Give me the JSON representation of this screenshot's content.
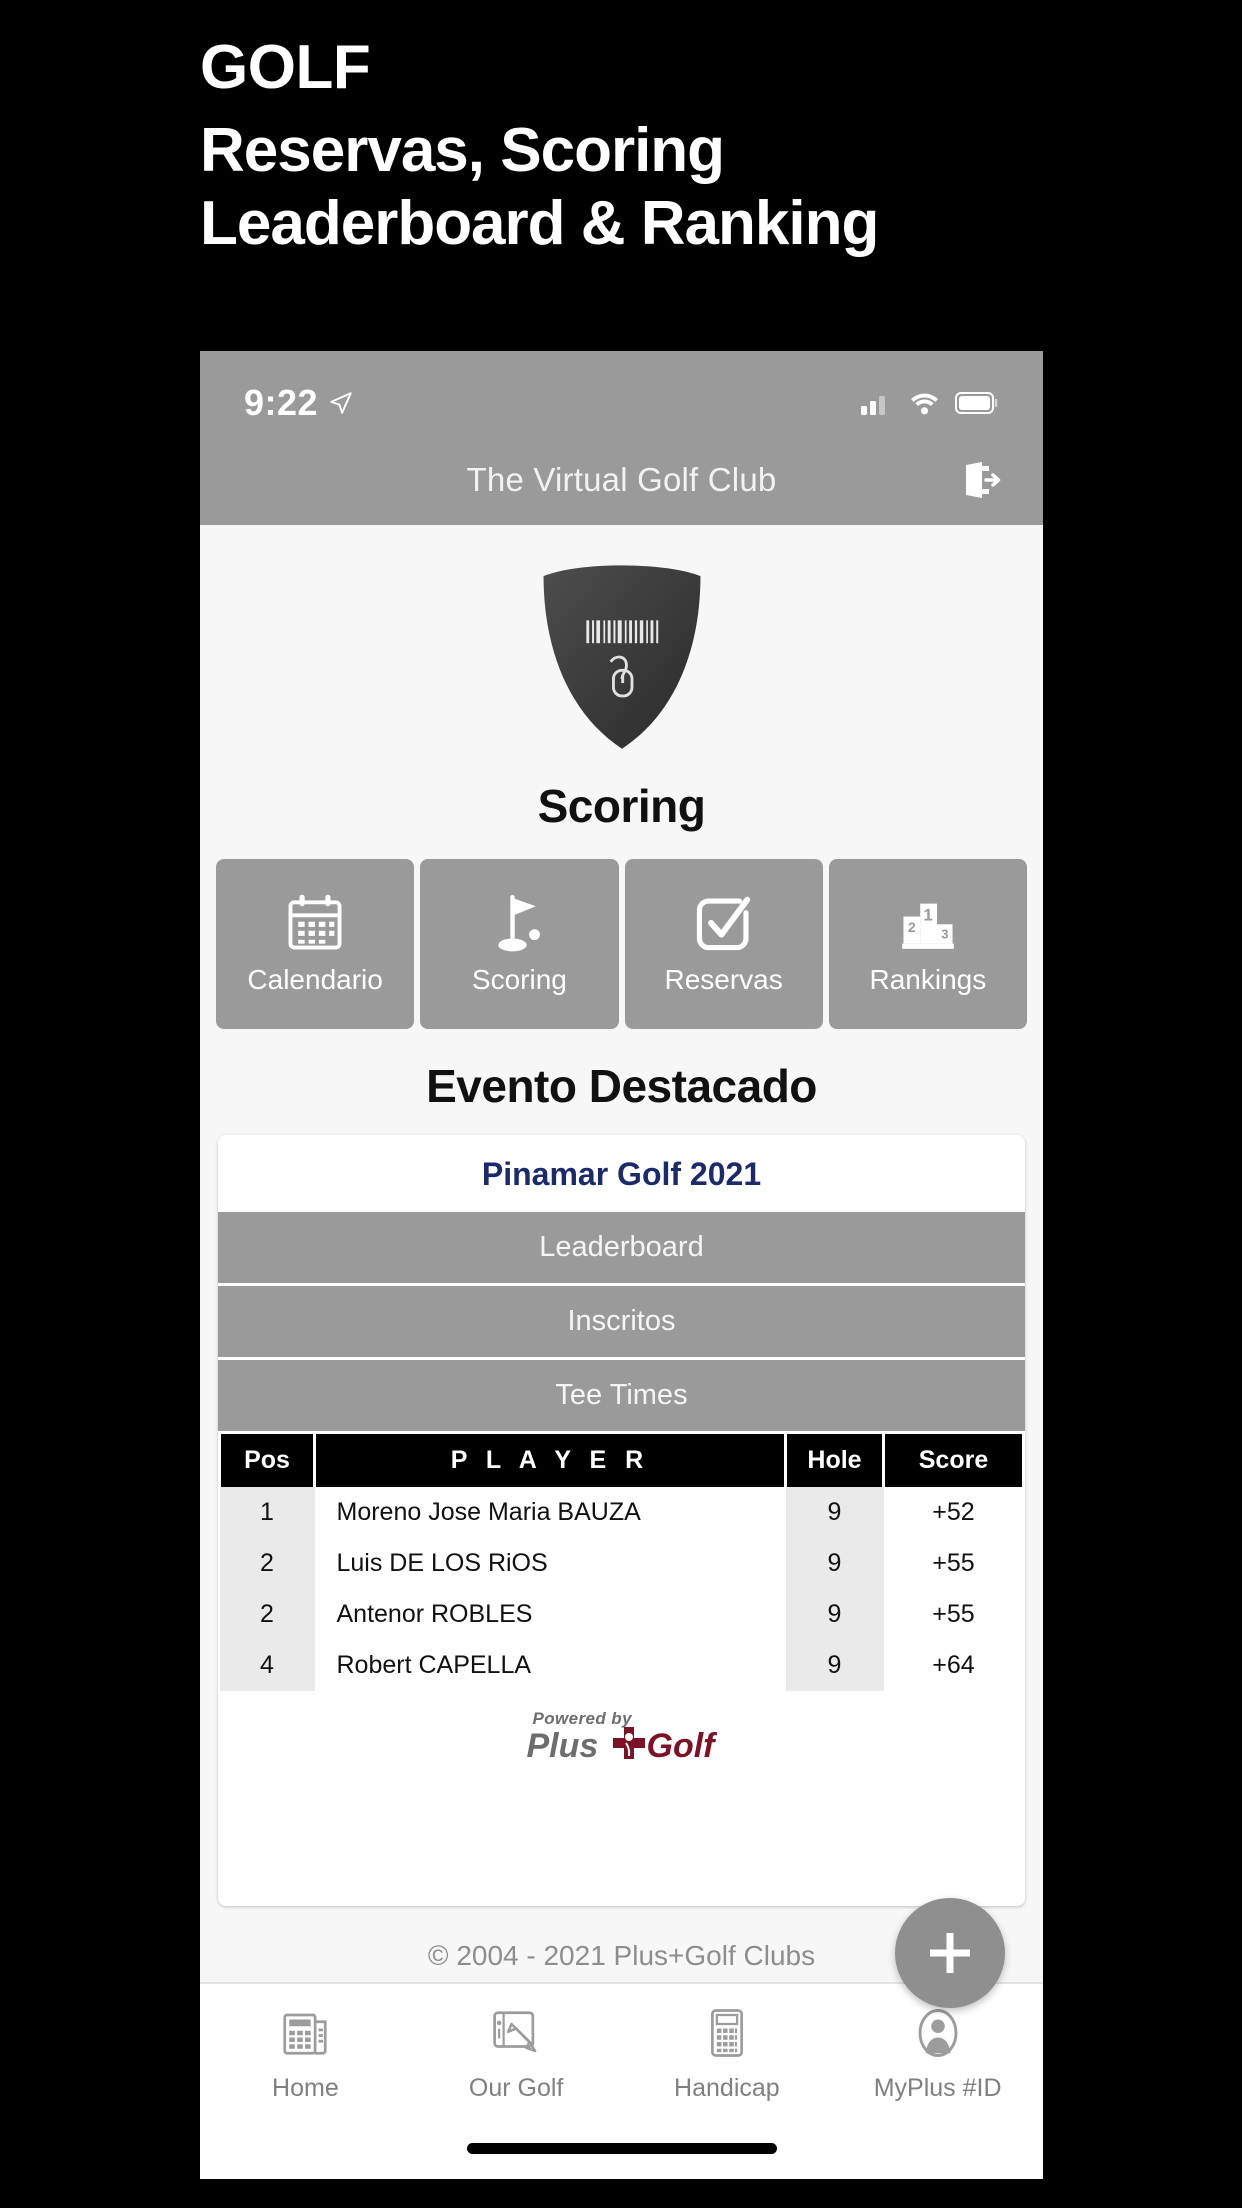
{
  "promo": {
    "kicker": "GOLF",
    "line1": "Reservas, Scoring",
    "line2": "Leaderboard & Ranking"
  },
  "statusbar": {
    "time": "9:22",
    "location_icon": "location-arrow-icon",
    "cellular_icon": "cellular-bars-icon",
    "wifi_icon": "wifi-icon",
    "battery_icon": "battery-icon"
  },
  "appbar": {
    "title": "The Virtual Golf Club",
    "logout_icon": "logout-icon"
  },
  "brand": {
    "shield_icon": "shield-badge-icon"
  },
  "page": {
    "title": "Scoring",
    "featured_heading": "Evento Destacado"
  },
  "tiles": [
    {
      "label": "Calendario",
      "icon": "calendar-icon"
    },
    {
      "label": "Scoring",
      "icon": "golf-flag-icon"
    },
    {
      "label": "Reservas",
      "icon": "check-square-icon"
    },
    {
      "label": "Rankings",
      "icon": "podium-icon"
    }
  ],
  "event": {
    "name": "Pinamar Golf 2021",
    "buttons": [
      "Leaderboard",
      "Inscritos",
      "Tee Times"
    ]
  },
  "leaderboard": {
    "headers": [
      "Pos",
      "P L A Y E R",
      "Hole",
      "Score"
    ],
    "rows": [
      {
        "pos": "1",
        "player": "Moreno Jose Maria BAUZA",
        "hole": "9",
        "score": "+52"
      },
      {
        "pos": "2",
        "player": "Luis DE LOS RiOS",
        "hole": "9",
        "score": "+55"
      },
      {
        "pos": "2",
        "player": "Antenor ROBLES",
        "hole": "9",
        "score": "+55"
      },
      {
        "pos": "4",
        "player": "Robert CAPELLA",
        "hole": "9",
        "score": "+64"
      }
    ]
  },
  "powered_by": {
    "prefix": "Powered by",
    "word1": "Plus",
    "word2": "Golf",
    "cross_icon": "plus-cross-icon"
  },
  "footer": {
    "copyright": "© 2004 - 2021 Plus+Golf Clubs",
    "fab_icon": "plus-icon"
  },
  "tabbar": [
    {
      "label": "Home",
      "icon": "newspaper-icon"
    },
    {
      "label": "Our Golf",
      "icon": "tablet-pen-icon"
    },
    {
      "label": "Handicap",
      "icon": "calculator-icon"
    },
    {
      "label": "MyPlus #ID",
      "icon": "person-icon"
    }
  ],
  "colors": {
    "backdrop": "#000000",
    "chrome_gray": "#9a9a9a",
    "event_title": "#1a2a6b",
    "golf_red": "#7d1126",
    "screen_bg": "#f7f7f7"
  }
}
